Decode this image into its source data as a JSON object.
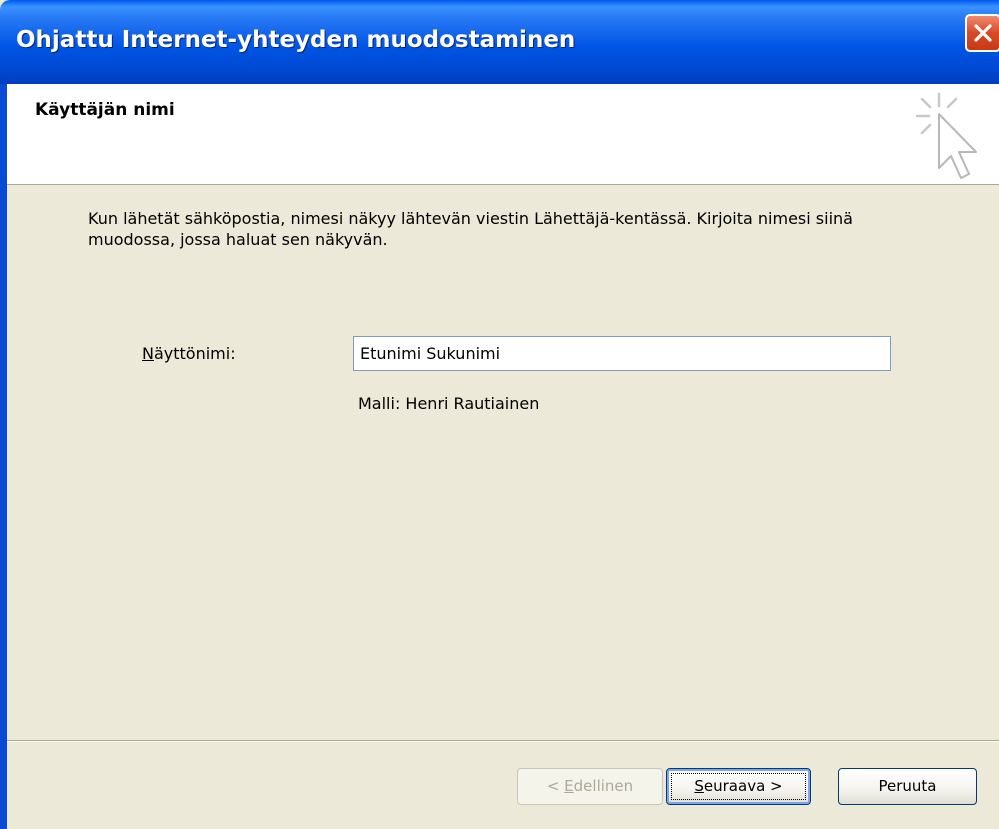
{
  "window": {
    "title": "Ohjattu Internet-yhteyden muodostaminen",
    "close_icon": "close-icon"
  },
  "header": {
    "heading": "Käyttäjän nimi",
    "icon": "wizard-cursor-icon"
  },
  "body": {
    "description": "Kun lähetät sähköpostia, nimesi näkyy lähtevän viestin Lähettäjä-kentässä. Kirjoita nimesi siinä muodossa, jossa haluat sen näkyvän.",
    "display_name_label_accel": "N",
    "display_name_label_rest": "äyttönimi:",
    "display_name_value": "Etunimi Sukunimi",
    "example": "Malli: Henri Rautiainen"
  },
  "buttons": {
    "back_prefix": "< ",
    "back_accel": "E",
    "back_rest": "dellinen",
    "next_accel": "S",
    "next_rest": "euraava >",
    "cancel": "Peruuta"
  },
  "colors": {
    "titlebar": "#0055e5",
    "dialog_bg": "#ece9d8",
    "close_button": "#d64a26"
  }
}
